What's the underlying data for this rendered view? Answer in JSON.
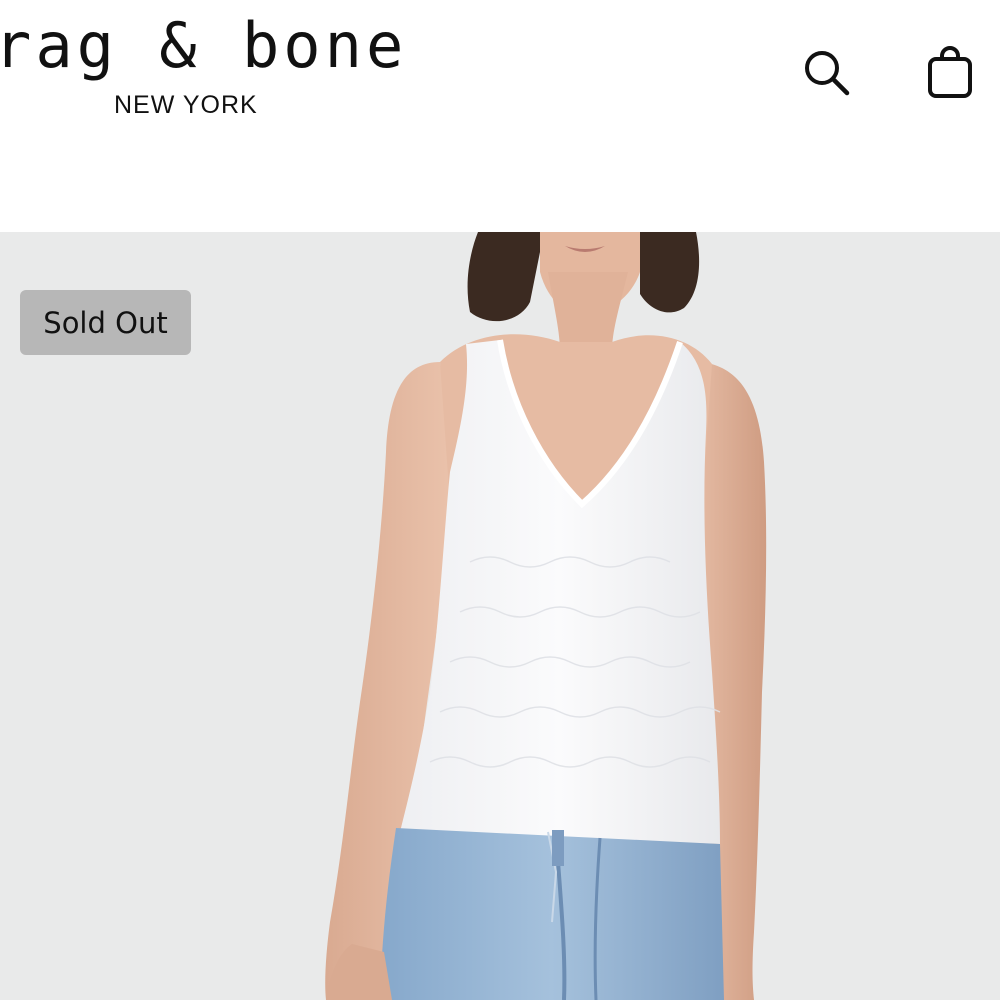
{
  "header": {
    "logo": {
      "brand": "rag & bone",
      "location": "NEW YORK"
    },
    "icons": {
      "search": "search-icon",
      "bag": "shopping-bag-icon"
    }
  },
  "product": {
    "badge": "Sold Out",
    "image": {
      "subject": "model-wearing-white-tank-and-blue-jeans"
    }
  },
  "colors": {
    "background": "#ffffff",
    "hero_background": "#e9eaea",
    "badge_background": "#b7b7b7",
    "text": "#111111",
    "tank_top": "#f7f7f8",
    "denim": "#8fb0d0"
  }
}
